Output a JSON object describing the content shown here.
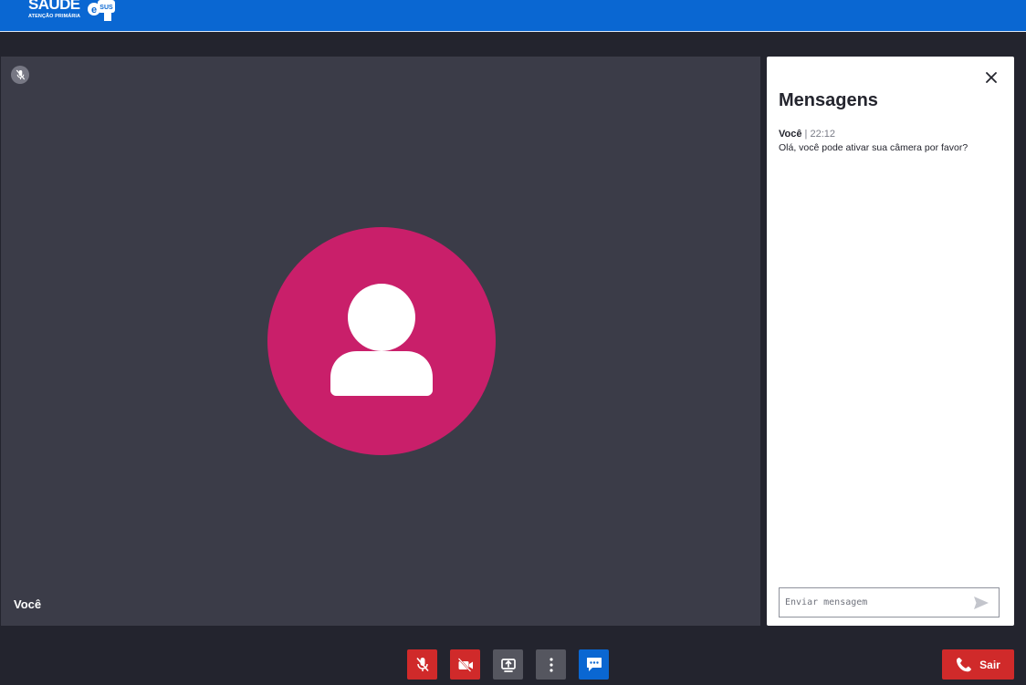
{
  "header": {
    "brand_name": "SAÚDE",
    "brand_subtitle": "ATENÇÃO PRIMÁRIA",
    "brand_badge": "SUS"
  },
  "video": {
    "participant_name": "Você",
    "mic_status_icon": "mic-off-icon"
  },
  "chat": {
    "title": "Mensagens",
    "messages": [
      {
        "author": "Você",
        "separator": "|",
        "time": "22:12",
        "text": "Olá, você pode ativar sua câmera por favor?"
      }
    ],
    "input_placeholder": "Enviar mensagem"
  },
  "controls": {
    "exit_label": "Sair"
  },
  "colors": {
    "header_blue": "#0a67d2",
    "background": "#23242e",
    "video_panel": "#3b3c48",
    "avatar": "#c91f6a",
    "danger": "#d02a2a",
    "control_gray": "#55565f"
  }
}
